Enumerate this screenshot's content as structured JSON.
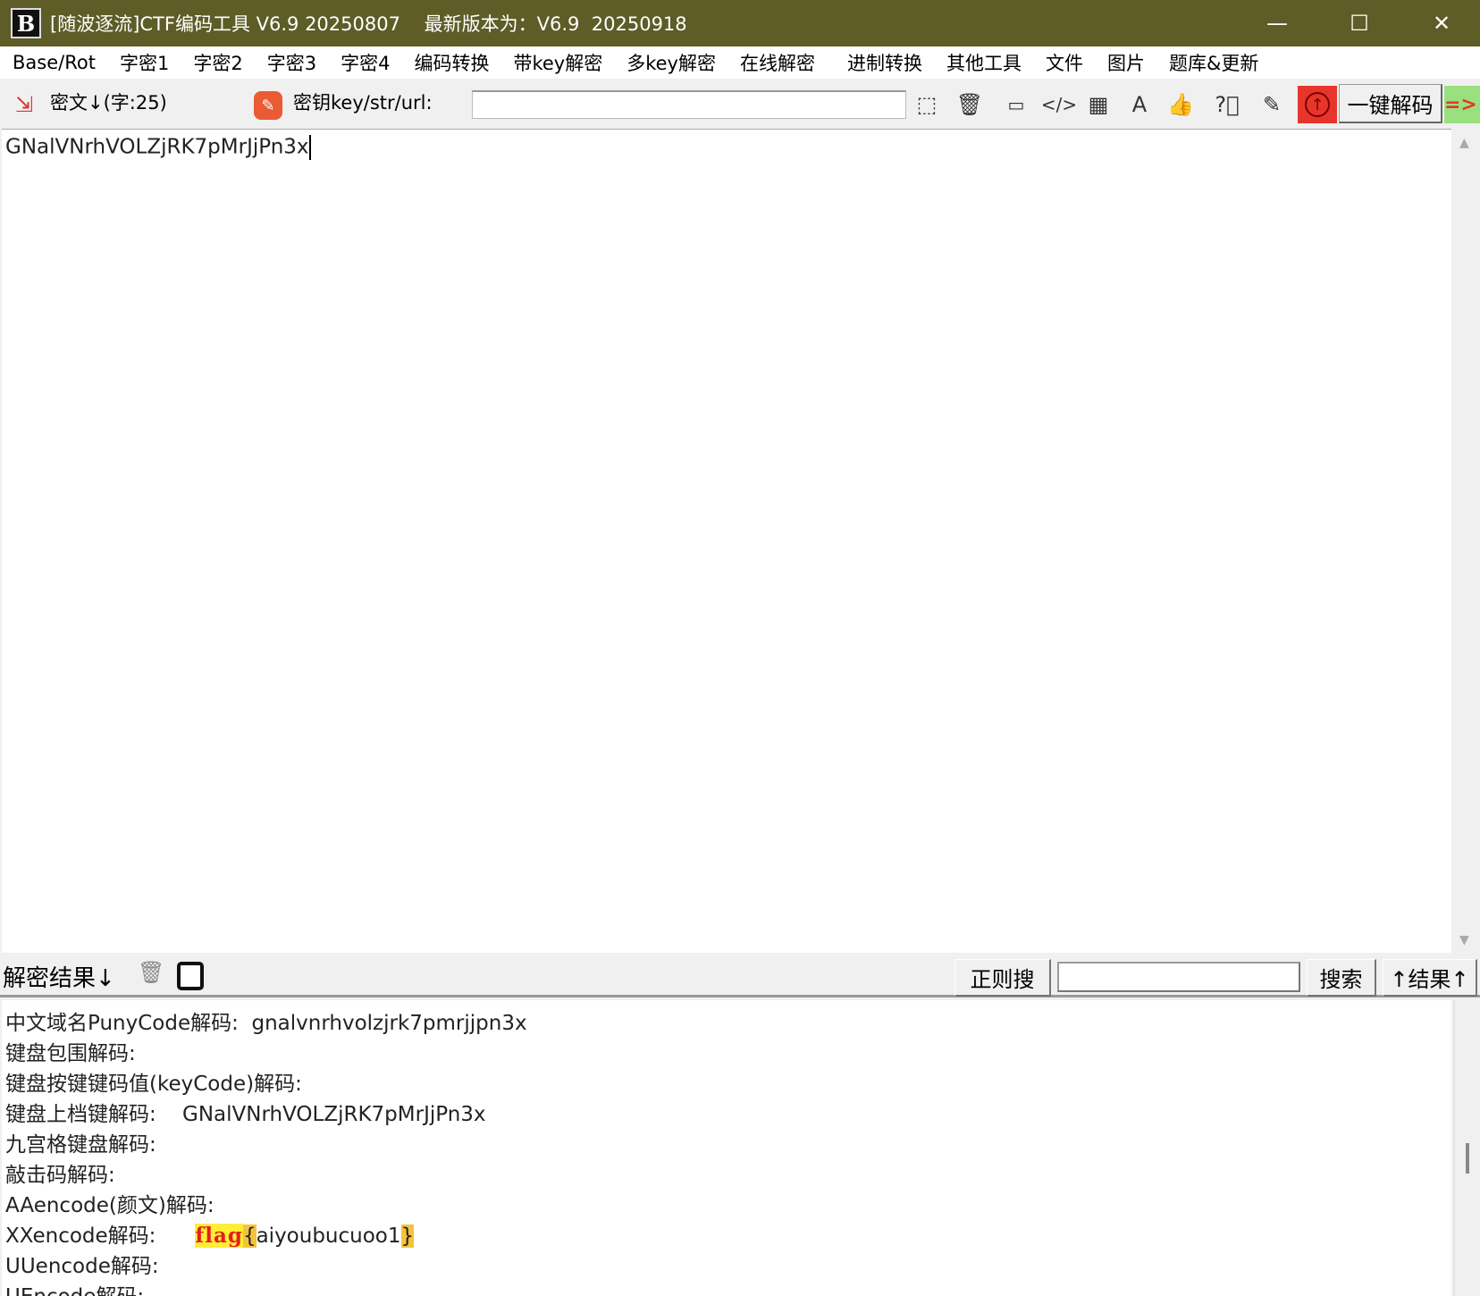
{
  "window": {
    "title": "[随波逐流]CTF编码工具 V6.9 20250807    最新版本为：V6.9  20250918",
    "logo": "B"
  },
  "menu": [
    "Base/Rot",
    "字密1",
    "字密2",
    "字密3",
    "字密4",
    "编码转换",
    "带key解密",
    "多key解密",
    "在线解密",
    "进制转换",
    "其他工具",
    "文件",
    "图片",
    "题库&更新"
  ],
  "toolbar": {
    "ciphertext_label": "密文↓(字:25)",
    "key_label": "密钥key/str/url:",
    "key_value": "",
    "decode_button": "一键解码",
    "arrow_label": "=>"
  },
  "editor": {
    "text": "GNalVNrhVOLZjRK7pMrJjPn3x"
  },
  "results_header": {
    "label": "解密结果↓",
    "regex_button": "正则搜",
    "search_value": "",
    "search_button": "搜索",
    "result_up_button": "↑结果↑"
  },
  "results": [
    {
      "label": "中文域名PunyCode解码:",
      "value": "  gnalvnrhvolzjrk7pmrjjpn3x"
    },
    {
      "label": "键盘包围解码:",
      "value": ""
    },
    {
      "label": "键盘按键键码值(keyCode)解码:",
      "value": ""
    },
    {
      "label": "键盘上档键解码:",
      "value": "    GNalVNrhVOLZjRK7pMrJjPn3x"
    },
    {
      "label": "九宫格键盘解码:",
      "value": ""
    },
    {
      "label": "敲击码解码:",
      "value": ""
    },
    {
      "label": "AAencode(颜文)解码:",
      "value": ""
    },
    {
      "label": "XXencode解码:",
      "value": "      ",
      "flag_word": "flag",
      "open_brace": "{",
      "flag_body": "aiyoubucuoo1",
      "close_brace": "}"
    },
    {
      "label": "UUencode解码:",
      "value": ""
    },
    {
      "label": "UEncode解码:",
      "value": ""
    }
  ]
}
